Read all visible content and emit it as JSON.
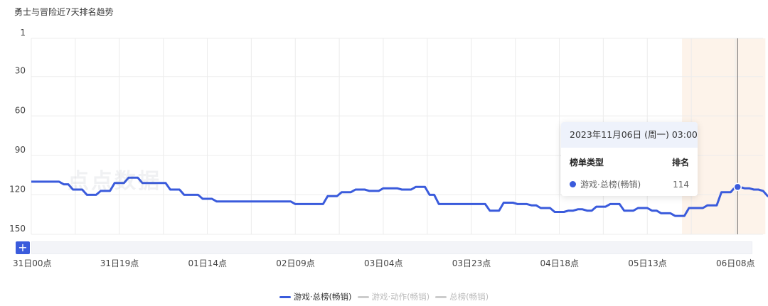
{
  "chart_data": {
    "type": "line",
    "title": "勇士与冒险近7天排名趋势",
    "y_axis": {
      "inverted": true,
      "ticks": [
        1,
        30,
        60,
        90,
        120,
        150
      ],
      "range": [
        1,
        150
      ]
    },
    "x_ticks": [
      "31日00点",
      "31日19点",
      "01日14点",
      "02日09点",
      "03日04点",
      "03日23点",
      "04日18点",
      "05日13点",
      "06日08点"
    ],
    "x_hours_total": 174,
    "highlight_band_hours": [
      140.5,
      158.5
    ],
    "grid": true,
    "legend_placement": "bottom",
    "series": [
      {
        "name": "游戏·总榜(畅销)",
        "color": "#3a5bdc",
        "points": [
          [
            0,
            110
          ],
          [
            6,
            110
          ],
          [
            7,
            112
          ],
          [
            8,
            112
          ],
          [
            9,
            116
          ],
          [
            11,
            116
          ],
          [
            12,
            120
          ],
          [
            14,
            120
          ],
          [
            15,
            117
          ],
          [
            17,
            117
          ],
          [
            18,
            111
          ],
          [
            20,
            111
          ],
          [
            21,
            107
          ],
          [
            23,
            107
          ],
          [
            24,
            111
          ],
          [
            29,
            111
          ],
          [
            30,
            116
          ],
          [
            32,
            116
          ],
          [
            33,
            120
          ],
          [
            36,
            120
          ],
          [
            37,
            123
          ],
          [
            39,
            123
          ],
          [
            40,
            125
          ],
          [
            56,
            125
          ],
          [
            57,
            127
          ],
          [
            63,
            127
          ],
          [
            64,
            121
          ],
          [
            66,
            121
          ],
          [
            67,
            118
          ],
          [
            69,
            118
          ],
          [
            70,
            116
          ],
          [
            72,
            116
          ],
          [
            73,
            117
          ],
          [
            75,
            117
          ],
          [
            76,
            115
          ],
          [
            79,
            115
          ],
          [
            80,
            116
          ],
          [
            82,
            116
          ],
          [
            83,
            114
          ],
          [
            85,
            114
          ],
          [
            86,
            120
          ],
          [
            87,
            120
          ],
          [
            88,
            127
          ],
          [
            98,
            127
          ],
          [
            99,
            132
          ],
          [
            101,
            132
          ],
          [
            102,
            126
          ],
          [
            104,
            126
          ],
          [
            105,
            127
          ],
          [
            107,
            127
          ],
          [
            108,
            128
          ],
          [
            109,
            128
          ],
          [
            110,
            130
          ],
          [
            112,
            130
          ],
          [
            113,
            133
          ],
          [
            115,
            133
          ],
          [
            116,
            132
          ],
          [
            117,
            132
          ],
          [
            118,
            131
          ],
          [
            119,
            131
          ],
          [
            120,
            132
          ],
          [
            121,
            132
          ],
          [
            122,
            129
          ],
          [
            124,
            129
          ],
          [
            125,
            127
          ],
          [
            127,
            127
          ],
          [
            128,
            132
          ],
          [
            130,
            132
          ],
          [
            131,
            130
          ],
          [
            133,
            130
          ],
          [
            134,
            132
          ],
          [
            135,
            132
          ],
          [
            136,
            134
          ],
          [
            138,
            134
          ],
          [
            139,
            136
          ],
          [
            141,
            136
          ],
          [
            142,
            130
          ],
          [
            145,
            130
          ],
          [
            146,
            128
          ],
          [
            148,
            128
          ],
          [
            149,
            118
          ],
          [
            151,
            118
          ],
          [
            152,
            114
          ],
          [
            153,
            114
          ],
          [
            154,
            115
          ],
          [
            155,
            115
          ],
          [
            156,
            116
          ],
          [
            157,
            116
          ],
          [
            158,
            117
          ],
          [
            159,
            121
          ],
          [
            161,
            121
          ],
          [
            162,
            123
          ],
          [
            164,
            123
          ]
        ],
        "tooltip": {
          "label": "游戏·总榜(畅销)",
          "value": 114
        }
      },
      {
        "name": "游戏·动作(畅销)",
        "color": "#cccccc",
        "points": []
      },
      {
        "name": "总榜(畅销)",
        "color": "#cccccc",
        "points": []
      }
    ],
    "hover_x_hours": 152.5
  },
  "tooltip": {
    "header": "2023年11月06日 (周一) 03:00",
    "col_type": "榜单类型",
    "col_rank": "排名",
    "row_label": "游戏·总榜(畅销)",
    "row_value": "114"
  },
  "legend": [
    {
      "label": "游戏·总榜(畅销)",
      "color": "#3a5bdc",
      "active": true
    },
    {
      "label": "游戏·动作(畅销)",
      "color": "#cccccc",
      "active": false
    },
    {
      "label": "总榜(畅销)",
      "color": "#cccccc",
      "active": false
    }
  ],
  "controls": {
    "zoom_plus": "+"
  },
  "watermark": "点点数据"
}
